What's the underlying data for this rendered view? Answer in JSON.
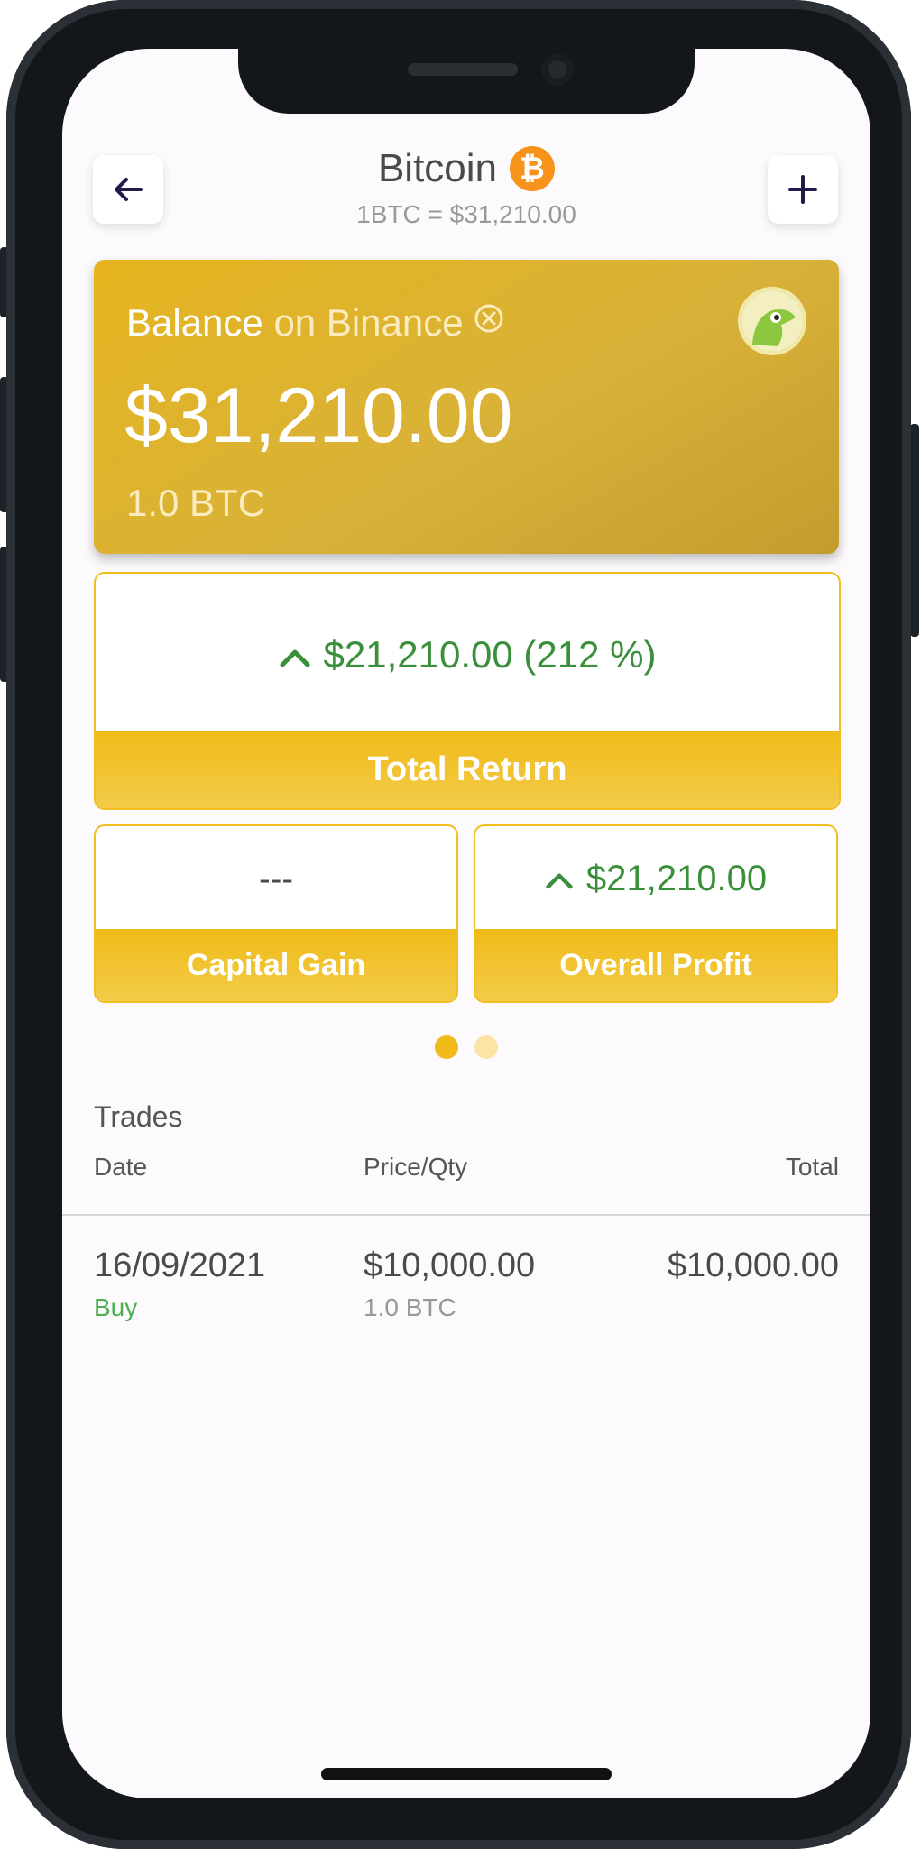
{
  "header": {
    "back_icon": "arrow-left-icon",
    "add_icon": "plus-icon",
    "coin_name": "Bitcoin",
    "coin_symbol_glyph": "₿",
    "rate": "1BTC = $31,210.00"
  },
  "balance": {
    "label": "Balance",
    "exchange": "on Binance",
    "remove_icon": "close-circle-icon",
    "amount": "$31,210.00",
    "quantity": "1.0 BTC",
    "provider_icon": "coingecko-icon"
  },
  "total_return": {
    "value": "$21,210.00 (212 %)",
    "label": "Total Return",
    "trend_icon": "chevron-up-icon"
  },
  "capital_gain": {
    "value": "---",
    "label": "Capital Gain"
  },
  "overall_profit": {
    "value": "$21,210.00",
    "label": "Overall Profit",
    "trend_icon": "chevron-up-icon"
  },
  "pager": {
    "count": 2,
    "active": 0
  },
  "trades": {
    "title": "Trades",
    "columns": [
      "Date",
      "Price/Qty",
      "Total"
    ],
    "rows": [
      {
        "date": "16/09/2021",
        "type": "Buy",
        "price": "$10,000.00",
        "qty": "1.0 BTC",
        "total": "$10,000.00"
      }
    ]
  },
  "colors": {
    "accent": "#f0bb18",
    "positive": "#3a8f3a",
    "buy": "#4caf50",
    "bitcoin": "#f7931a"
  }
}
